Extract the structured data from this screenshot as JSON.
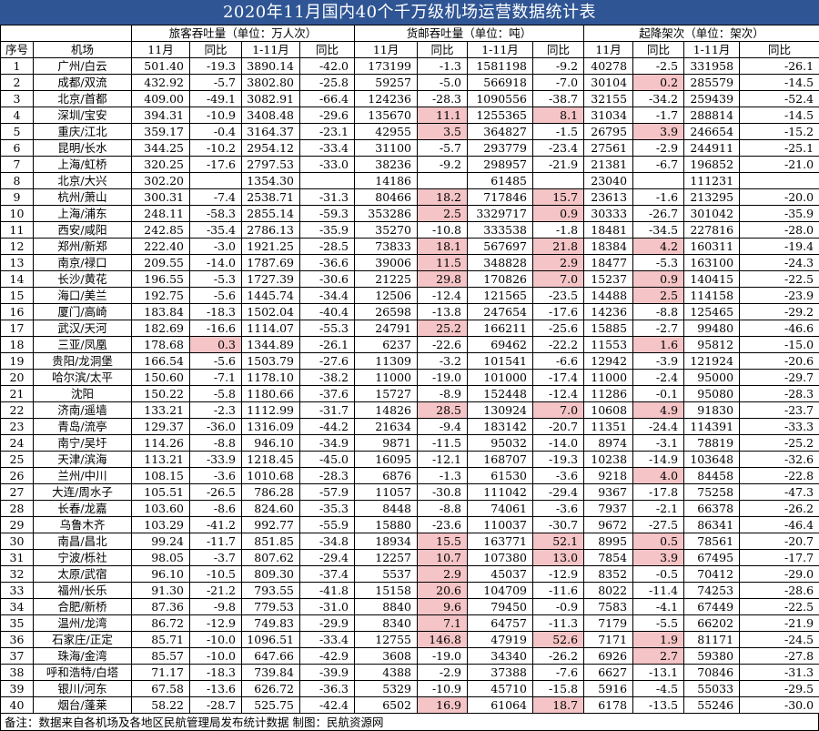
{
  "title": "2020年11月国内40个千万级机场运营数据统计表",
  "groups": {
    "passenger": "旅客吞吐量（单位：万人次）",
    "cargo": "货邮吞吐量（单位：吨）",
    "flights": "起降架次（单位：架次）"
  },
  "columns": [
    "序号",
    "机场",
    "11月",
    "同比",
    "1-11月",
    "同比",
    "11月",
    "同比",
    "1-11月",
    "同比",
    "11月",
    "同比",
    "1-11月",
    "同比"
  ],
  "highlight_color": "#f4c4c6",
  "rows": [
    [
      "1",
      "广州/白云",
      "501.40",
      "-19.3",
      "3890.14",
      "-42.0",
      "173199",
      "-1.3",
      "1581198",
      "-9.2",
      "40278",
      "-2.5",
      "331958",
      "-26.1"
    ],
    [
      "2",
      "成都/双流",
      "432.92",
      "-5.7",
      "3802.80",
      "-25.8",
      "59257",
      "-5.0",
      "566918",
      "-7.0",
      "30104",
      "0.2",
      "285579",
      "-14.5"
    ],
    [
      "3",
      "北京/首都",
      "409.00",
      "-49.1",
      "3082.91",
      "-66.4",
      "124236",
      "-28.3",
      "1090556",
      "-38.7",
      "32155",
      "-34.2",
      "259439",
      "-52.4"
    ],
    [
      "4",
      "深圳/宝安",
      "394.31",
      "-10.9",
      "3408.48",
      "-29.6",
      "135670",
      "11.1",
      "1255365",
      "8.1",
      "31034",
      "-1.7",
      "288814",
      "-14.5"
    ],
    [
      "5",
      "重庆/江北",
      "359.17",
      "-0.4",
      "3164.37",
      "-23.1",
      "42955",
      "3.5",
      "364827",
      "-1.5",
      "26795",
      "3.9",
      "246654",
      "-15.2"
    ],
    [
      "6",
      "昆明/长水",
      "344.25",
      "-10.2",
      "2954.12",
      "-33.4",
      "31100",
      "-5.7",
      "293779",
      "-23.4",
      "27561",
      "-2.9",
      "244911",
      "-25.1"
    ],
    [
      "7",
      "上海/虹桥",
      "320.25",
      "-17.6",
      "2797.53",
      "-33.0",
      "38236",
      "-9.2",
      "298957",
      "-21.9",
      "21381",
      "-6.7",
      "196852",
      "-21.0"
    ],
    [
      "8",
      "北京/大兴",
      "302.20",
      "",
      "1354.30",
      "",
      "14186",
      "",
      "61485",
      "",
      "23040",
      "",
      "111231",
      ""
    ],
    [
      "9",
      "杭州/萧山",
      "300.31",
      "-7.4",
      "2538.71",
      "-31.3",
      "80466",
      "18.2",
      "717846",
      "15.7",
      "23613",
      "-1.6",
      "213295",
      "-20.0"
    ],
    [
      "10",
      "上海/浦东",
      "248.11",
      "-58.3",
      "2855.14",
      "-59.3",
      "353286",
      "2.5",
      "3329717",
      "0.9",
      "30333",
      "-26.7",
      "301042",
      "-35.9"
    ],
    [
      "11",
      "西安/咸阳",
      "242.85",
      "-35.4",
      "2786.13",
      "-35.9",
      "35270",
      "-10.8",
      "333538",
      "-1.8",
      "18481",
      "-34.5",
      "227816",
      "-28.0"
    ],
    [
      "12",
      "郑州/新郑",
      "222.40",
      "-3.0",
      "1921.25",
      "-28.5",
      "73833",
      "18.1",
      "567697",
      "21.8",
      "18384",
      "4.2",
      "160311",
      "-19.4"
    ],
    [
      "13",
      "南京/禄口",
      "209.55",
      "-14.0",
      "1787.69",
      "-36.6",
      "39006",
      "11.5",
      "348828",
      "2.9",
      "18477",
      "-5.3",
      "163100",
      "-24.3"
    ],
    [
      "14",
      "长沙/黄花",
      "196.55",
      "-5.3",
      "1727.39",
      "-30.6",
      "21225",
      "29.8",
      "170826",
      "7.0",
      "15237",
      "0.9",
      "140415",
      "-22.5"
    ],
    [
      "15",
      "海口/美兰",
      "192.75",
      "-5.6",
      "1445.74",
      "-34.4",
      "12506",
      "-12.4",
      "121565",
      "-23.5",
      "14488",
      "2.5",
      "114158",
      "-23.9"
    ],
    [
      "16",
      "厦门/高崎",
      "183.84",
      "-18.3",
      "1502.04",
      "-40.4",
      "26598",
      "-13.8",
      "247654",
      "-17.6",
      "14236",
      "-8.8",
      "125465",
      "-29.2"
    ],
    [
      "17",
      "武汉/天河",
      "182.69",
      "-16.6",
      "1114.07",
      "-55.3",
      "24791",
      "25.2",
      "166211",
      "-25.6",
      "15885",
      "-2.7",
      "99480",
      "-46.6"
    ],
    [
      "18",
      "三亚/凤凰",
      "178.68",
      "0.3",
      "1344.89",
      "-26.1",
      "6237",
      "-22.6",
      "69462",
      "-22.2",
      "11553",
      "1.6",
      "95812",
      "-15.0"
    ],
    [
      "19",
      "贵阳/龙洞堡",
      "166.54",
      "-5.6",
      "1503.79",
      "-27.6",
      "11309",
      "-3.2",
      "101541",
      "-6.6",
      "12942",
      "-3.9",
      "121924",
      "-20.6"
    ],
    [
      "20",
      "哈尔滨/太平",
      "150.60",
      "-7.1",
      "1178.10",
      "-38.2",
      "11000",
      "-19.0",
      "101000",
      "-17.4",
      "11000",
      "-2.4",
      "95000",
      "-29.7"
    ],
    [
      "21",
      "沈阳",
      "150.22",
      "-5.8",
      "1180.66",
      "-37.6",
      "15727",
      "-8.9",
      "152448",
      "-12.4",
      "11286",
      "-0.1",
      "95080",
      "-28.3"
    ],
    [
      "22",
      "济南/遥墙",
      "133.21",
      "-2.3",
      "1112.99",
      "-31.7",
      "14826",
      "28.5",
      "130924",
      "7.0",
      "10608",
      "4.9",
      "91830",
      "-23.7"
    ],
    [
      "23",
      "青岛/流亭",
      "129.37",
      "-36.0",
      "1316.09",
      "-44.2",
      "21634",
      "-9.4",
      "183142",
      "-20.7",
      "11351",
      "-24.4",
      "114391",
      "-33.3"
    ],
    [
      "24",
      "南宁/吴圩",
      "114.26",
      "-8.8",
      "946.10",
      "-34.9",
      "9871",
      "-11.5",
      "95032",
      "-14.0",
      "8974",
      "-3.1",
      "78819",
      "-25.2"
    ],
    [
      "25",
      "天津/滨海",
      "113.21",
      "-33.9",
      "1218.45",
      "-45.0",
      "16095",
      "-12.1",
      "168707",
      "-19.3",
      "10238",
      "-14.9",
      "103648",
      "-32.6"
    ],
    [
      "26",
      "兰州/中川",
      "108.15",
      "-3.6",
      "1010.68",
      "-28.3",
      "6876",
      "-1.3",
      "61530",
      "-3.6",
      "9218",
      "4.0",
      "84458",
      "-22.8"
    ],
    [
      "27",
      "大连/周水子",
      "105.51",
      "-26.5",
      "786.28",
      "-57.9",
      "11057",
      "-30.8",
      "111042",
      "-29.4",
      "9367",
      "-17.8",
      "75258",
      "-47.3"
    ],
    [
      "28",
      "长春/龙嘉",
      "103.60",
      "-8.6",
      "824.60",
      "-35.3",
      "8448",
      "-8.8",
      "74061",
      "-3.6",
      "7937",
      "-2.1",
      "66378",
      "-26.2"
    ],
    [
      "29",
      "乌鲁木齐",
      "103.29",
      "-41.2",
      "992.77",
      "-55.9",
      "15880",
      "-23.6",
      "110037",
      "-30.7",
      "9672",
      "-27.5",
      "86341",
      "-46.4"
    ],
    [
      "30",
      "南昌/昌北",
      "99.24",
      "-11.7",
      "851.85",
      "-34.8",
      "18934",
      "15.5",
      "163771",
      "52.1",
      "8995",
      "0.5",
      "78561",
      "-20.7"
    ],
    [
      "31",
      "宁波/栎社",
      "98.05",
      "-3.7",
      "807.62",
      "-29.4",
      "12257",
      "10.7",
      "107380",
      "13.0",
      "7854",
      "3.9",
      "67495",
      "-17.7"
    ],
    [
      "32",
      "太原/武宿",
      "96.10",
      "-10.5",
      "809.30",
      "-37.4",
      "5537",
      "2.9",
      "45037",
      "-12.9",
      "8352",
      "-0.5",
      "70412",
      "-29.0"
    ],
    [
      "33",
      "福州/长乐",
      "91.30",
      "-21.2",
      "793.55",
      "-41.8",
      "15158",
      "20.6",
      "104709",
      "-11.6",
      "8022",
      "-11.4",
      "74253",
      "-28.6"
    ],
    [
      "34",
      "合肥/新桥",
      "87.36",
      "-9.8",
      "779.53",
      "-31.0",
      "8840",
      "9.6",
      "79450",
      "-0.9",
      "7583",
      "-4.1",
      "67449",
      "-22.5"
    ],
    [
      "35",
      "温州/龙湾",
      "86.72",
      "-12.9",
      "749.83",
      "-29.9",
      "8340",
      "7.1",
      "64757",
      "-11.3",
      "7179",
      "-5.5",
      "66202",
      "-21.9"
    ],
    [
      "36",
      "石家庄/正定",
      "85.71",
      "-10.0",
      "1096.51",
      "-33.4",
      "12755",
      "146.8",
      "47919",
      "52.6",
      "7171",
      "1.9",
      "81171",
      "-24.5"
    ],
    [
      "37",
      "珠海/金湾",
      "85.57",
      "-10.0",
      "647.66",
      "-42.9",
      "3608",
      "-19.0",
      "34340",
      "-26.2",
      "6926",
      "2.7",
      "59380",
      "-27.8"
    ],
    [
      "38",
      "呼和浩特/白塔",
      "71.17",
      "-18.3",
      "739.84",
      "-39.9",
      "4388",
      "-2.9",
      "37388",
      "-7.6",
      "6627",
      "-13.1",
      "70846",
      "-31.3"
    ],
    [
      "39",
      "银川/河东",
      "67.58",
      "-13.6",
      "626.72",
      "-36.3",
      "5329",
      "-10.9",
      "45710",
      "-15.8",
      "5916",
      "-4.5",
      "55033",
      "-29.5"
    ],
    [
      "40",
      "烟台/蓬莱",
      "58.22",
      "-28.7",
      "525.75",
      "-42.4",
      "6502",
      "16.9",
      "61064",
      "18.7",
      "6178",
      "-13.5",
      "55246",
      "-30.0"
    ]
  ],
  "highlights": {
    "2": [
      11
    ],
    "4": [
      7,
      9
    ],
    "5": [
      7,
      11
    ],
    "9": [
      7,
      9
    ],
    "10": [
      7,
      9
    ],
    "12": [
      7,
      9,
      11
    ],
    "13": [
      7,
      9
    ],
    "14": [
      7,
      9,
      11
    ],
    "15": [
      11
    ],
    "17": [
      7
    ],
    "18": [
      3,
      11
    ],
    "22": [
      7,
      9,
      11
    ],
    "26": [
      11
    ],
    "30": [
      7,
      9,
      11
    ],
    "31": [
      7,
      9,
      11
    ],
    "32": [
      7
    ],
    "33": [
      7
    ],
    "34": [
      7
    ],
    "35": [
      7
    ],
    "36": [
      7,
      9,
      11
    ],
    "37": [
      11
    ],
    "40": [
      7,
      9
    ]
  },
  "note": "备注：数据来自各机场及各地区民航管理局发布统计数据 制图：民航资源网"
}
